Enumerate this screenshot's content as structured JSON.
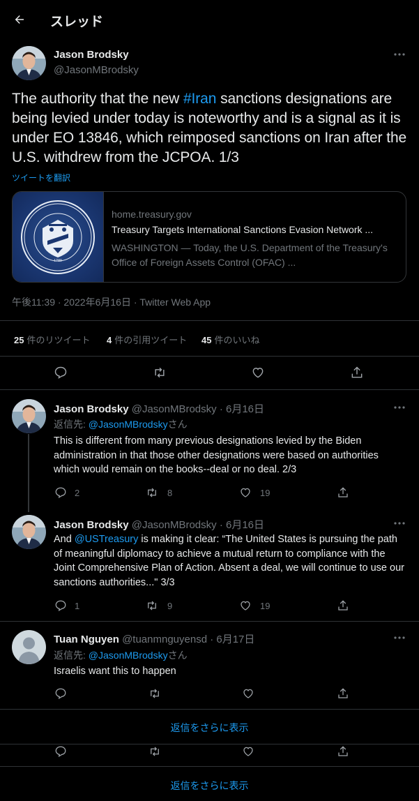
{
  "header": {
    "title": "スレッド"
  },
  "main_tweet": {
    "name": "Jason Brodsky",
    "handle": "@JasonMBrodsky",
    "text_before": "The authority that the new ",
    "hashtag": "#Iran",
    "text_after": " sanctions designations are being levied under today is noteworthy and is a signal as it is under EO 13846, which reimposed sanctions on Iran after the U.S. withdrew from the JCPOA. 1/3",
    "translate_label": "ツイートを翻訳",
    "card": {
      "domain": "home.treasury.gov",
      "title": "Treasury Targets International Sanctions Evasion Network ...",
      "description": "WASHINGTON — Today, the U.S. Department of the Treasury's Office of Foreign Assets Control (OFAC) ...",
      "seal_text": "THE DEPARTMENT OF THE TREASURY",
      "seal_year": "1789"
    },
    "timestamp": "午後11:39 · 2022年6月16日 · Twitter Web App",
    "stats": {
      "retweets": "25",
      "retweets_label": "件のリツイート",
      "quotes": "4",
      "quotes_label": "件の引用ツイート",
      "likes": "45",
      "likes_label": "件のいいね"
    }
  },
  "replies": [
    {
      "name": "Jason Brodsky",
      "meta": "@JasonMBrodsky · 6月16日",
      "reply_prefix": "返信先: ",
      "reply_to": "@JasonMBrodsky",
      "reply_suffix": "さん",
      "text": "This is different from many previous designations levied by the Biden administration in that those other designations were based on authorities which would remain on the books--deal or no deal. 2/3",
      "replies": "2",
      "retweets": "8",
      "likes": "19"
    },
    {
      "name": "Jason Brodsky",
      "meta": "@JasonMBrodsky · 6月16日",
      "text_before": "And ",
      "mention": "@USTreasury",
      "text_after": " is making it clear: “The United States is pursuing the path of meaningful diplomacy to achieve a mutual return to compliance with the Joint Comprehensive Plan of Action. Absent a deal, we will continue to use our sanctions authorities...\" 3/3",
      "replies": "1",
      "retweets": "9",
      "likes": "19"
    },
    {
      "name": "Tuan Nguyen",
      "meta": "@tuanmnguyensd · 6月17日",
      "reply_prefix": "返信先: ",
      "reply_to": "@JasonMBrodsky",
      "reply_suffix": "さん",
      "text": "Israelis want this to happen"
    }
  ],
  "show_more_label_1": "返信をさらに表示",
  "show_more_label_2": "返信をさらに表示",
  "colors": {
    "accent": "#1d9bf0",
    "muted": "#71767b",
    "border": "#2f3336",
    "background": "#000000"
  }
}
